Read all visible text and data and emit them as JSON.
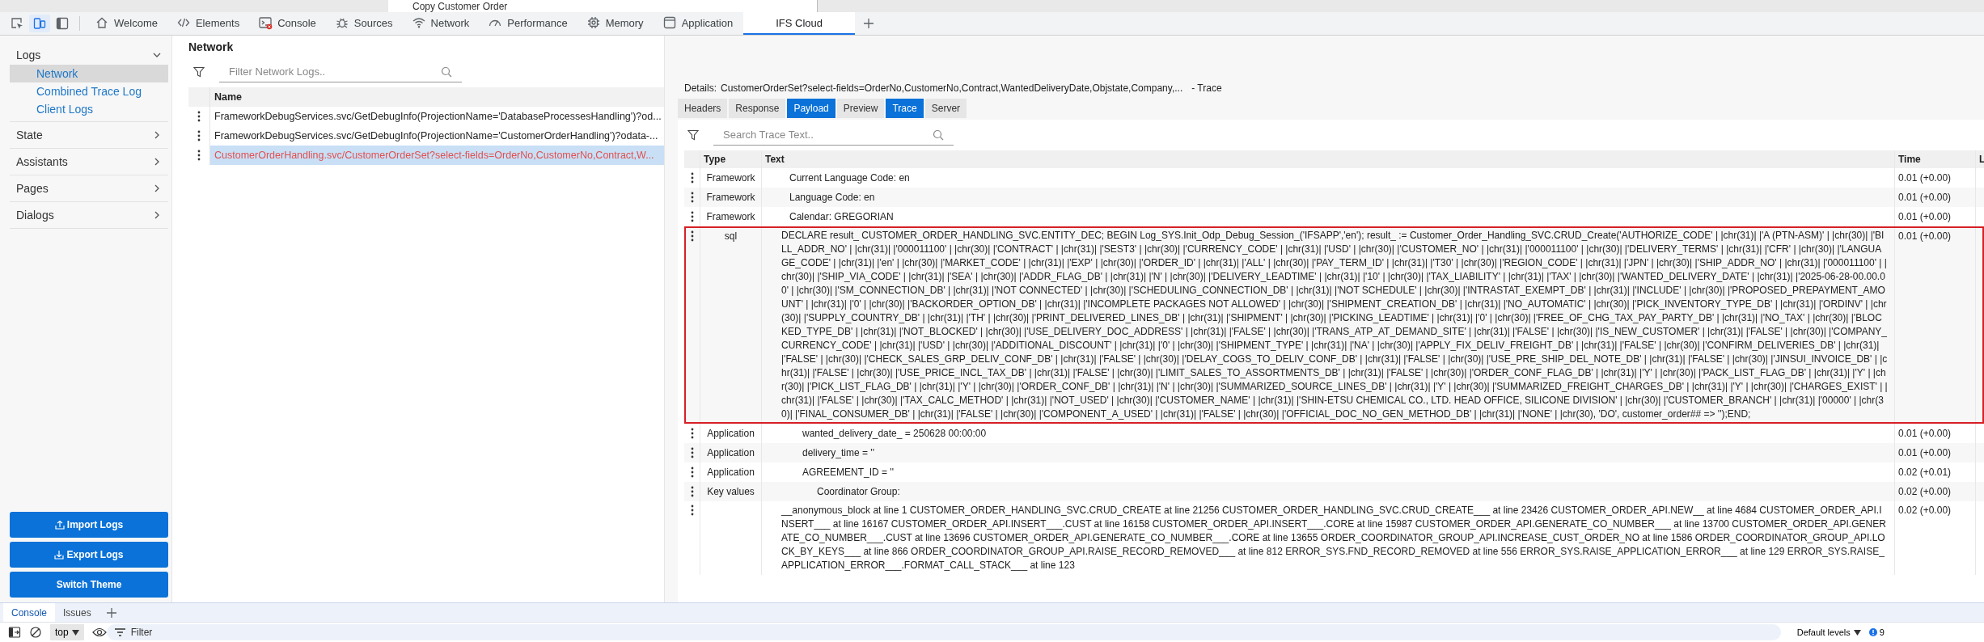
{
  "background_page": {
    "title": "Copy Customer Order"
  },
  "devtools": {
    "toggles": [
      {
        "kind": "inspect",
        "on": false
      },
      {
        "kind": "device",
        "on": true
      },
      {
        "kind": "sidebar",
        "on": false
      }
    ],
    "tabs": [
      {
        "label": "Welcome",
        "kind": "home",
        "selected": false,
        "error_badge": false
      },
      {
        "label": "Elements",
        "kind": "code",
        "selected": false,
        "error_badge": false
      },
      {
        "label": "Console",
        "kind": "console",
        "selected": false,
        "error_badge": true
      },
      {
        "label": "Sources",
        "kind": "bug",
        "selected": false,
        "error_badge": false
      },
      {
        "label": "Network",
        "kind": "wifi",
        "selected": false,
        "error_badge": false
      },
      {
        "label": "Performance",
        "kind": "gauge",
        "selected": false,
        "error_badge": false
      },
      {
        "label": "Memory",
        "kind": "chip",
        "selected": false,
        "error_badge": false
      },
      {
        "label": "Application",
        "kind": "window",
        "selected": false,
        "error_badge": false
      },
      {
        "label": "IFS Cloud",
        "kind": "none",
        "selected": true,
        "error_badge": false
      }
    ]
  },
  "sidebar": {
    "sections": [
      {
        "label": "Logs",
        "expanded": true,
        "items": [
          {
            "label": "Network",
            "selected": true
          },
          {
            "label": "Combined Trace Log",
            "selected": false
          },
          {
            "label": "Client Logs",
            "selected": false
          }
        ]
      },
      {
        "label": "State",
        "expanded": false
      },
      {
        "label": "Assistants",
        "expanded": false
      },
      {
        "label": "Pages",
        "expanded": false
      },
      {
        "label": "Dialogs",
        "expanded": false
      }
    ],
    "buttons": [
      {
        "label": "Import Logs",
        "kind": "import"
      },
      {
        "label": "Export Logs",
        "kind": "export"
      },
      {
        "label": "Switch Theme",
        "kind": "plain"
      }
    ]
  },
  "network": {
    "title": "Network",
    "filter": {
      "placeholder": "Filter Network Logs.."
    },
    "columns": [
      "Name"
    ],
    "rows": [
      {
        "name": "FrameworkDebugServices.svc/GetDebugInfo(ProjectionName='DatabaseProcessesHandling')?od...",
        "selected": false,
        "error": false
      },
      {
        "name": "FrameworkDebugServices.svc/GetDebugInfo(ProjectionName='CustomerOrderHandling')?odata-...",
        "selected": false,
        "error": false
      },
      {
        "name": "CustomerOrderHandling.svc/CustomerOrderSet?select-fields=OrderNo,CustomerNo,Contract,W...",
        "selected": true,
        "error": true
      }
    ]
  },
  "details": {
    "label": "Details:",
    "request": "CustomerOrderSet?select-fields=OrderNo,CustomerNo,Contract,WantedDeliveryDate,Objstate,Company,...",
    "view": "- Trace",
    "tabs": [
      {
        "label": "Headers",
        "selected": false
      },
      {
        "label": "Response",
        "selected": false
      },
      {
        "label": "Payload",
        "selected": true
      },
      {
        "label": "Preview",
        "selected": false
      },
      {
        "label": "Trace",
        "selected": true
      },
      {
        "label": "Server",
        "selected": false
      }
    ],
    "search": {
      "placeholder": "Search Trace Text.."
    },
    "columns": [
      "Type",
      "Text",
      "Time",
      "L"
    ],
    "rows": [
      {
        "kind": "framework",
        "type": "Framework",
        "text": "Current Language Code: en",
        "time": "0.01 (+0.00)",
        "highlighted": false
      },
      {
        "kind": "framework",
        "type": "Framework",
        "text": "Language Code: en",
        "time": "0.01 (+0.00)",
        "highlighted": false
      },
      {
        "kind": "framework",
        "type": "Framework",
        "text": "Calendar: GREGORIAN",
        "time": "0.01 (+0.00)",
        "highlighted": false
      },
      {
        "kind": "sql",
        "type": "sql",
        "text": "DECLARE result_ CUSTOMER_ORDER_HANDLING_SVC.ENTITY_DEC; BEGIN Log_SYS.Init_Odp_Debug_Session_('IFSAPP','en'); result_ := Customer_Order_Handling_SVC.CRUD_Create('AUTHORIZE_CODE' | |chr(31)| |'A (PTN-ASM)' | |chr(30)| |'BILL_ADDR_NO' | |chr(31)| |'000011100' | |chr(30)| |'CONTRACT' | |chr(31)| |'SEST3' | |chr(30)| |'CURRENCY_CODE' | |chr(31)| |'USD' | |chr(30)| |'CUSTOMER_NO' | |chr(31)| |'000011100' | |chr(30)| |'DELIVERY_TERMS' | |chr(31)| |'CFR' | |chr(30)| |'LANGUAGE_CODE' | |chr(31)| |'en' | |chr(30)| |'MARKET_CODE' | |chr(31)| |'EXP' | |chr(30)| |'ORDER_ID' | |chr(31)| |'ALL' | |chr(30)| |'PAY_TERM_ID' | |chr(31)| |'T30' | |chr(30)| |'REGION_CODE' | |chr(31)| |'JPN' | |chr(30)| |'SHIP_ADDR_NO' | |chr(31)| |'000011100' | |chr(30)| |'SHIP_VIA_CODE' | |chr(31)| |'SEA' | |chr(30)| |'ADDR_FLAG_DB' | |chr(31)| |'N' | |chr(30)| |'DELIVERY_LEADTIME' | |chr(31)| |'10' | |chr(30)| |'TAX_LIABILITY' | |chr(31)| |'TAX' | |chr(30)| |'WANTED_DELIVERY_DATE' | |chr(31)| |'2025-06-28-00.00.00' | |chr(30)| |'SM_CONNECTION_DB' | |chr(31)| |'NOT CONNECTED' | |chr(30)| |'SCHEDULING_CONNECTION_DB' | |chr(31)| |'NOT SCHEDULE' | |chr(30)| |'INTRASTAT_EXEMPT_DB' | |chr(31)| |'INCLUDE' | |chr(30)| |'PROPOSED_PREPAYMENT_AMOUNT' | |chr(31)| |'0' | |chr(30)| |'BACKORDER_OPTION_DB' | |chr(31)| |'INCOMPLETE PACKAGES NOT ALLOWED' | |chr(30)| |'SHIPMENT_CREATION_DB' | |chr(31)| |'NO_AUTOMATIC' | |chr(30)| |'PICK_INVENTORY_TYPE_DB' | |chr(31)| |'ORDINV' | |chr(30)| |'SUPPLY_COUNTRY_DB' | |chr(31)| |'TH' | |chr(30)| |'PRINT_DELIVERED_LINES_DB' | |chr(31)| |'SHIPMENT' | |chr(30)| |'PICKING_LEADTIME' | |chr(31)| |'0' | |chr(30)| |'FREE_OF_CHG_TAX_PAY_PARTY_DB' | |chr(31)| |'NO_TAX' | |chr(30)| |'BLOCKED_TYPE_DB' | |chr(31)| |'NOT_BLOCKED' | |chr(30)| |'USE_DELIVERY_DOC_ADDRESS' | |chr(31)| |'FALSE' | |chr(30)| |'TRANS_ATP_AT_DEMAND_SITE' | |chr(31)| |'FALSE' | |chr(30)| |'IS_NEW_CUSTOMER' | |chr(31)| |'FALSE' | |chr(30)| |'COMPANY_CURRENCY_CODE' | |chr(31)| |'USD' | |chr(30)| |'ADDITIONAL_DISCOUNT' | |chr(31)| |'0' | |chr(30)| |'SHIPMENT_TYPE' | |chr(31)| |'NA' | |chr(30)| |'APPLY_FIX_DELIV_FREIGHT_DB' | |chr(31)| |'FALSE' | |chr(30)| |'CONFIRM_DELIVERIES_DB' | |chr(31)| |'FALSE' | |chr(30)| |'CHECK_SALES_GRP_DELIV_CONF_DB' | |chr(31)| |'FALSE' | |chr(30)| |'DELAY_COGS_TO_DELIV_CONF_DB' | |chr(31)| |'FALSE' | |chr(30)| |'USE_PRE_SHIP_DEL_NOTE_DB' | |chr(31)| |'FALSE' | |chr(30)| |'JINSUI_INVOICE_DB' | |chr(31)| |'FALSE' | |chr(30)| |'USE_PRICE_INCL_TAX_DB' | |chr(31)| |'FALSE' | |chr(30)| |'LIMIT_SALES_TO_ASSORTMENTS_DB' | |chr(31)| |'FALSE' | |chr(30)| |'ORDER_CONF_FLAG_DB' | |chr(31)| |'Y' | |chr(30)| |'PACK_LIST_FLAG_DB' | |chr(31)| |'Y' | |chr(30)| |'PICK_LIST_FLAG_DB' | |chr(31)| |'Y' | |chr(30)| |'ORDER_CONF_DB' | |chr(31)| |'N' | |chr(30)| |'SUMMARIZED_SOURCE_LINES_DB' | |chr(31)| |'Y' | |chr(30)| |'SUMMARIZED_FREIGHT_CHARGES_DB' | |chr(31)| |'Y' | |chr(30)| |'CHARGES_EXIST' | |chr(31)| |'FALSE' | |chr(30)| |'TAX_CALC_METHOD' | |chr(31)| |'NOT_USED' | |chr(30)| |'CUSTOMER_NAME' | |chr(31)| |'SHIN-ETSU CHEMICAL CO., LTD. HEAD OFFICE, SILICONE DIVISION' | |chr(30)| |'CUSTOMER_BRANCH' | |chr(31)| |'00000' | |chr(30)| |'FINAL_CONSUMER_DB' | |chr(31)| |'FALSE' | |chr(30)| |'COMPONENT_A_USED' | |chr(31)| |'FALSE' | |chr(30)| |'OFFICIAL_DOC_NO_GEN_METHOD_DB' | |chr(31)| |'NONE' | |chr(30), 'DO', customer_order## => '');END;",
        "time": "0.01 (+0.00)",
        "highlighted": true
      },
      {
        "kind": "application",
        "type": "Application",
        "text": "wanted_delivery_date_ = 250628 00:00:00",
        "time": "0.01 (+0.00)",
        "highlighted": false
      },
      {
        "kind": "application",
        "type": "Application",
        "text": "delivery_time = ''",
        "time": "0.01 (+0.00)",
        "highlighted": false
      },
      {
        "kind": "application",
        "type": "Application",
        "text": "AGREEMENT_ID = ''",
        "time": "0.02 (+0.01)",
        "highlighted": false
      },
      {
        "kind": "keyvalues",
        "type": "Key values",
        "text": "Coordinator Group:",
        "time": "0.02 (+0.00)",
        "highlighted": false
      },
      {
        "kind": "stack",
        "text": "__anonymous_block at line 1 CUSTOMER_ORDER_HANDLING_SVC.CRUD_CREATE at line 21256 CUSTOMER_ORDER_HANDLING_SVC.CRUD_CREATE___ at line 23426 CUSTOMER_ORDER_API.NEW__ at line 4684 CUSTOMER_ORDER_API.INSERT___ at line 16167 CUSTOMER_ORDER_API.INSERT___.CUST at line 16158 CUSTOMER_ORDER_API.INSERT___.CORE at line 15987 CUSTOMER_ORDER_API.GENERATE_CO_NUMBER___ at line 13700 CUSTOMER_ORDER_API.GENERATE_CO_NUMBER___.CUST at line 13696 CUSTOMER_ORDER_API.GENERATE_CO_NUMBER___.CORE at line 13655 ORDER_COORDINATOR_GROUP_API.INCREASE_CUST_ORDER_NO at line 1586 ORDER_COORDINATOR_GROUP_API.LOCK_BY_KEYS___ at line 866 ORDER_COORDINATOR_GROUP_API.RAISE_RECORD_REMOVED___ at line 812 ERROR_SYS.FND_RECORD_REMOVED at line 556 ERROR_SYS.RAISE_APPLICATION_ERROR___ at line 129 ERROR_SYS.RAISE_APPLICATION_ERROR___.FORMAT_CALL_STACK___ at line 123",
        "time": "0.02 (+0.00)",
        "highlighted": false
      }
    ]
  },
  "console_drawer": {
    "tabs": [
      {
        "label": "Console",
        "selected": true
      },
      {
        "label": "Issues",
        "selected": false
      }
    ],
    "context": "top",
    "filter": {
      "placeholder": "Filter"
    },
    "levels": "Default levels",
    "issues_count": "9"
  }
}
